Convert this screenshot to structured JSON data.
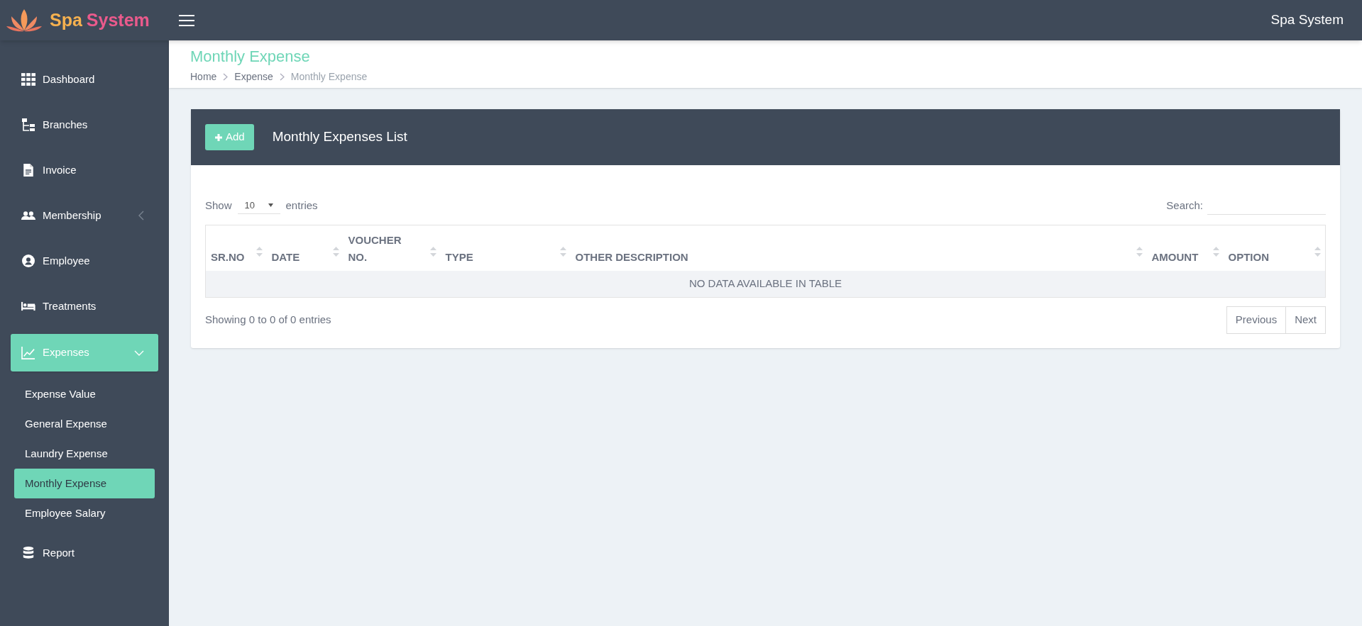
{
  "brand": {
    "word_1": "Spa",
    "word_2": "System"
  },
  "header": {
    "title": "Spa System"
  },
  "sidebar": {
    "items": [
      {
        "label": "Dashboard",
        "kind": "link",
        "selected": false
      },
      {
        "label": "Branches",
        "kind": "link",
        "selected": false
      },
      {
        "label": "Invoice",
        "kind": "link",
        "selected": false
      },
      {
        "label": "Membership",
        "kind": "group",
        "expanded": false,
        "selected": false
      },
      {
        "label": "Employee",
        "kind": "link",
        "selected": false
      },
      {
        "label": "Treatments",
        "kind": "link",
        "selected": false
      },
      {
        "label": "Expenses",
        "kind": "group",
        "expanded": true,
        "selected": true,
        "children": [
          {
            "label": "Expense Value",
            "selected": false
          },
          {
            "label": "General Expense",
            "selected": false
          },
          {
            "label": "Laundry Expense",
            "selected": false
          },
          {
            "label": "Monthly Expense",
            "selected": true
          },
          {
            "label": "Employee Salary",
            "selected": false
          }
        ]
      },
      {
        "label": "Report",
        "kind": "link",
        "selected": false
      }
    ]
  },
  "page": {
    "title": "Monthly Expense",
    "breadcrumb": [
      "Home",
      "Expense",
      "Monthly Expense"
    ]
  },
  "card": {
    "add_button": "Add",
    "title": "Monthly Expenses List",
    "show_label": "Show",
    "page_size": "10",
    "entries_label": "entries",
    "search_label": "Search:",
    "table": {
      "columns": [
        "SR.NO",
        "DATE",
        "VOUCHER NO.",
        "TYPE",
        "OTHER DESCRIPTION",
        "AMOUNT",
        "OPTION"
      ],
      "empty_message": "NO DATA AVAILABLE IN TABLE"
    },
    "info": "Showing 0 to 0 of 0 entries",
    "pagination": [
      {
        "label": "Previous",
        "disabled": true
      },
      {
        "label": "Next",
        "disabled": true
      }
    ]
  }
}
